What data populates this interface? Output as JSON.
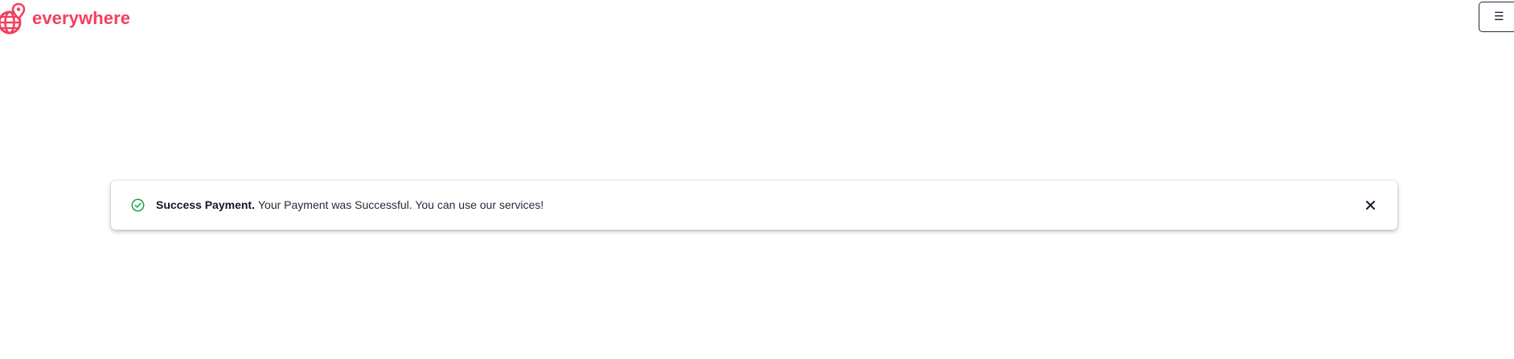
{
  "brand": {
    "name": "everywhere",
    "logo_icon": "globe-pin-icon",
    "color": "#f43f5e"
  },
  "header": {
    "menu_glyph": "☰",
    "menu_icon": "hamburger-menu-icon"
  },
  "alert": {
    "status": "success",
    "status_icon": "check-circle-icon",
    "status_color": "#16a34a",
    "title": "Success Payment.",
    "message": "Your Payment was Successful. You can use our services!",
    "close_icon": "close-icon"
  }
}
